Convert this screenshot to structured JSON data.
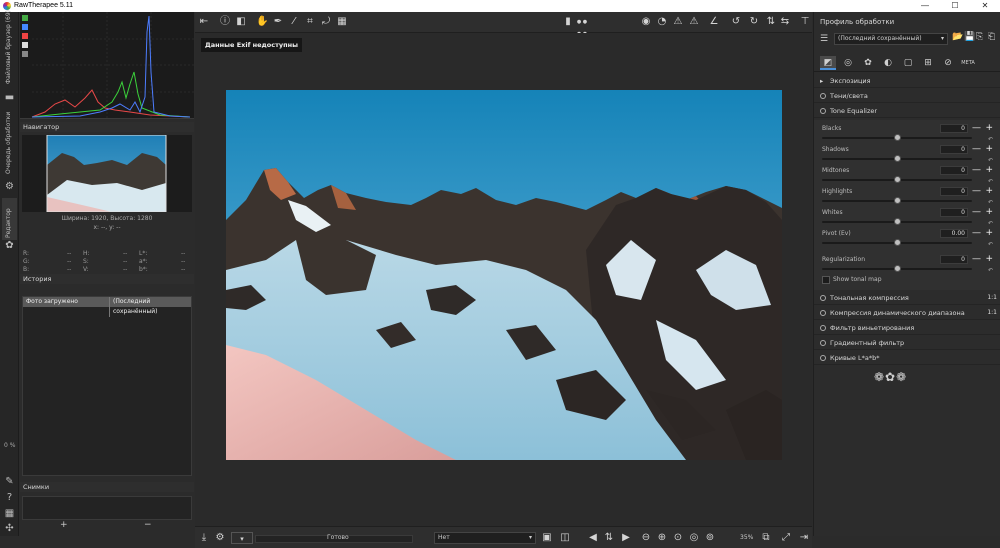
{
  "window": {
    "title": "RawTherapee 5.11",
    "minimize": "—",
    "maximize": "☐",
    "close": "✕"
  },
  "vtabs": {
    "file_browser": "Файловый браузер (69)",
    "queue": "Очередь обработки",
    "editor": "Редактор"
  },
  "left": {
    "navigator_title": "Навигатор",
    "size_info": "Ширина: 1920, Высота: 1280",
    "coords": "x: --, y: --",
    "readouts": [
      {
        "k": "R:",
        "v": "--",
        "k2": "H:",
        "v2": "--",
        "k3": "L*:",
        "v3": "--"
      },
      {
        "k": "G:",
        "v": "--",
        "k2": "S:",
        "v2": "--",
        "k3": "a*:",
        "v3": "--"
      },
      {
        "k": "B:",
        "v": "--",
        "k2": "V:",
        "v2": "--",
        "k3": "b*:",
        "v3": "--"
      }
    ],
    "history_title": "История",
    "history_row": {
      "action": "Фото загружено",
      "value": "(Последний сохранённый)"
    },
    "snapshots_title": "Снимки",
    "add": "+",
    "remove": "−",
    "zoom_pct": "0 %"
  },
  "center": {
    "exif_label": "Данные Exif недоступны",
    "status": "Готово",
    "preview_select": "Нет",
    "zoom": "35%"
  },
  "right": {
    "profile_title": "Профиль обработки",
    "profile_value": "(Последний сохранённый)",
    "tools": [
      {
        "label": "Экспозиция",
        "badge": ""
      },
      {
        "label": "Тени/света",
        "badge": ""
      },
      {
        "label": "Tone Equalizer",
        "badge": ""
      }
    ],
    "sliders": [
      {
        "label": "Blacks",
        "value": "0",
        "pos": 0.5
      },
      {
        "label": "Shadows",
        "value": "0",
        "pos": 0.5
      },
      {
        "label": "Midtones",
        "value": "0",
        "pos": 0.5
      },
      {
        "label": "Highlights",
        "value": "0",
        "pos": 0.5
      },
      {
        "label": "Whites",
        "value": "0",
        "pos": 0.5
      },
      {
        "label": "Pivot (Ev)",
        "value": "0.00",
        "pos": 0.5
      },
      {
        "label": "Regularization",
        "value": "0",
        "pos": 0.5
      }
    ],
    "show_tonal_map": "Show tonal map",
    "more_tools": [
      {
        "label": "Тональная компрессия",
        "badge": "1:1"
      },
      {
        "label": "Компрессия динамического диапазона",
        "badge": "1:1"
      },
      {
        "label": "Фильтр виньетирования",
        "badge": ""
      },
      {
        "label": "Градиентный фильтр",
        "badge": ""
      },
      {
        "label": "Кривые L*a*b*",
        "badge": ""
      }
    ],
    "meta_tab": "META"
  }
}
